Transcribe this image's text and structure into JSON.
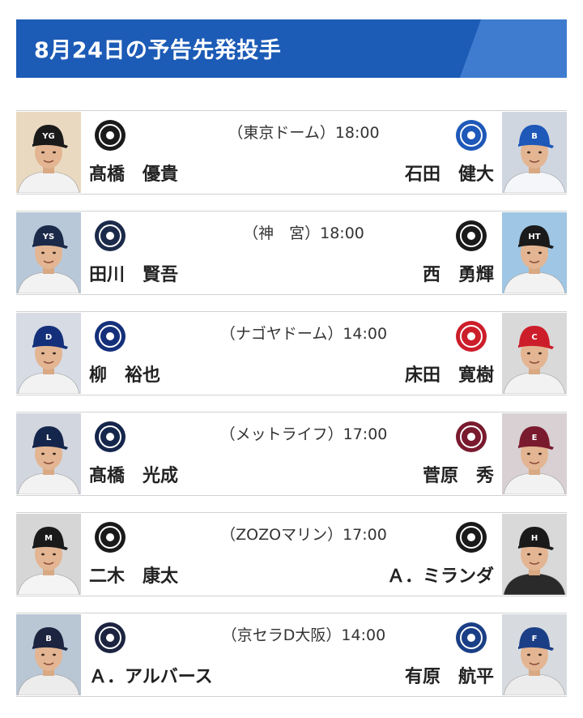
{
  "title": "8月24日の予告先発投手",
  "games": [
    {
      "venue": "（東京ドーム）18:00",
      "home": {
        "pitcher": "髙橋　優貴",
        "team_logo": "giants-logo-icon",
        "cap_color": "#1a1a1a",
        "cap_mark": "YG",
        "uniform": "#f2f2f2",
        "bg": "#e9d9c0"
      },
      "away": {
        "pitcher": "石田　健大",
        "team_logo": "baystars-logo-icon",
        "cap_color": "#1e58b8",
        "cap_mark": "B",
        "uniform": "#f4f6fa",
        "bg": "#cfd6e0"
      }
    },
    {
      "venue": "（神　宮）18:00",
      "home": {
        "pitcher": "田川　賢吾",
        "team_logo": "swallows-logo-icon",
        "cap_color": "#1c2a4a",
        "cap_mark": "YS",
        "uniform": "#f2f2f2",
        "bg": "#b9c8d8"
      },
      "away": {
        "pitcher": "西　勇輝",
        "team_logo": "tigers-logo-icon",
        "cap_color": "#1a1a1a",
        "cap_mark": "HT",
        "uniform": "#f2f2f2",
        "bg": "#9fc6e4"
      }
    },
    {
      "venue": "（ナゴヤドーム）14:00",
      "home": {
        "pitcher": "柳　裕也",
        "team_logo": "dragons-logo-icon",
        "cap_color": "#14307a",
        "cap_mark": "D",
        "uniform": "#f2f2f2",
        "bg": "#d6dbe4"
      },
      "away": {
        "pitcher": "床田　寛樹",
        "team_logo": "carp-logo-icon",
        "cap_color": "#cc1e2a",
        "cap_mark": "C",
        "uniform": "#f2f2f2",
        "bg": "#d9d9d9"
      }
    },
    {
      "venue": "（メットライフ）17:00",
      "home": {
        "pitcher": "髙橋　光成",
        "team_logo": "lions-logo-icon",
        "cap_color": "#15264c",
        "cap_mark": "L",
        "uniform": "#f2f2f2",
        "bg": "#d2d6de"
      },
      "away": {
        "pitcher": "菅原　秀",
        "team_logo": "eagles-logo-icon",
        "cap_color": "#7a1a2e",
        "cap_mark": "E",
        "uniform": "#f2f2f2",
        "bg": "#d8d0d2"
      }
    },
    {
      "venue": "（ZOZOマリン）17:00",
      "home": {
        "pitcher": "二木　康太",
        "team_logo": "marines-logo-icon",
        "cap_color": "#1a1a1a",
        "cap_mark": "M",
        "uniform": "#f4f4f4",
        "bg": "#d6d6d6"
      },
      "away": {
        "pitcher": "Ａ．ミランダ",
        "team_logo": "hawks-logo-icon",
        "cap_color": "#1a1a1a",
        "cap_mark": "H",
        "uniform": "#2a2a2a",
        "bg": "#d9d9d9"
      }
    },
    {
      "venue": "（京セラD大阪）14:00",
      "home": {
        "pitcher": "Ａ．アルバース",
        "team_logo": "buffaloes-logo-icon",
        "cap_color": "#1c2440",
        "cap_mark": "B",
        "uniform": "#ececec",
        "bg": "#b9c6d4"
      },
      "away": {
        "pitcher": "有原　航平",
        "team_logo": "fighters-logo-icon",
        "cap_color": "#1b3f86",
        "cap_mark": "F",
        "uniform": "#ececec",
        "bg": "#d7dbe0"
      }
    }
  ]
}
